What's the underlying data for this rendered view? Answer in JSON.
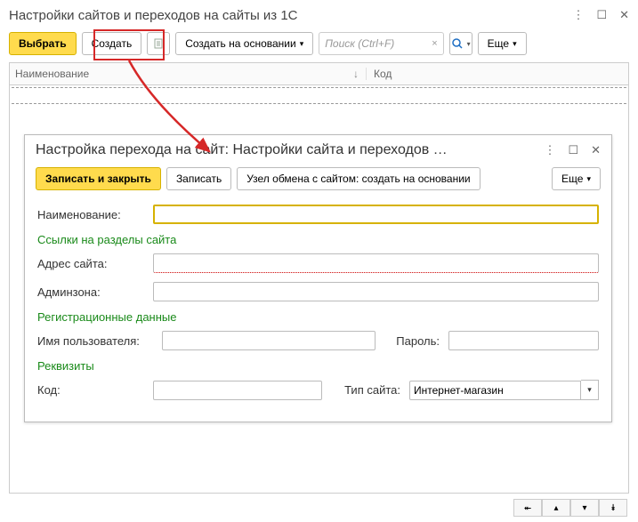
{
  "window": {
    "title": "Настройки сайтов и переходов на сайты из 1С"
  },
  "toolbar": {
    "select_label": "Выбрать",
    "create_label": "Создать",
    "create_based_label": "Создать на основании",
    "search_placeholder": "Поиск (Ctrl+F)",
    "more_label": "Еще"
  },
  "table": {
    "cols": {
      "name": "Наименование",
      "code": "Код"
    }
  },
  "child": {
    "title": "Настройка перехода на сайт: Настройки сайта и переходов …",
    "buttons": {
      "save_close": "Записать и закрыть",
      "save": "Записать",
      "node_based": "Узел обмена с сайтом: создать на основании",
      "more": "Еще"
    },
    "labels": {
      "name": "Наименование:",
      "links_section": "Ссылки на разделы сайта",
      "site_addr": "Адрес сайта:",
      "adminzone": "Админзона:",
      "reg_section": "Регистрационные данные",
      "username": "Имя пользователя:",
      "password": "Пароль:",
      "props_section": "Реквизиты",
      "code": "Код:",
      "site_type": "Тип сайта:"
    },
    "fields": {
      "name": "",
      "site_addr": "",
      "adminzone": "",
      "username": "",
      "password": "",
      "code": "",
      "site_type": "Интернет-магазин"
    }
  }
}
